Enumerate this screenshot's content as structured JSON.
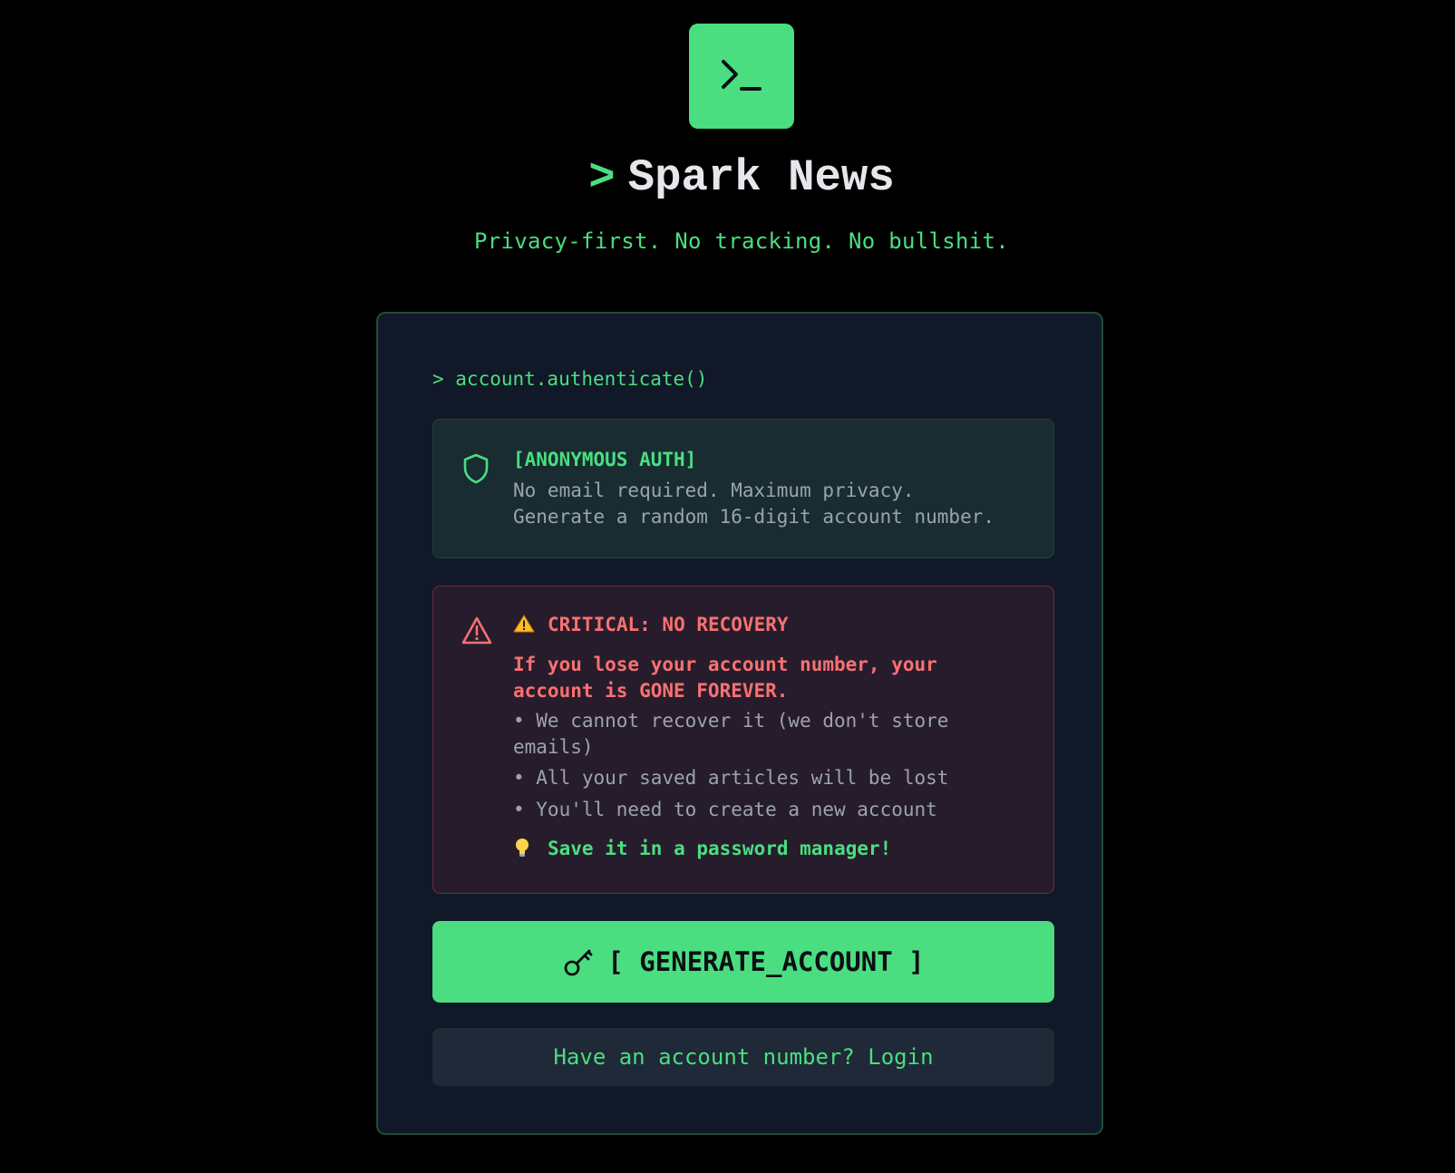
{
  "brand": {
    "logo_icon": "terminal-icon",
    "prompt_symbol": ">",
    "name": "Spark News",
    "tagline": "Privacy-first. No tracking. No bullshit."
  },
  "card": {
    "command": "> account.authenticate()",
    "info": {
      "icon": "shield-icon",
      "title": "[ANONYMOUS AUTH]",
      "line1": "No email required. Maximum privacy.",
      "line2": "Generate a random 16-digit account number."
    },
    "warning": {
      "icon": "alert-triangle-icon",
      "title": "CRITICAL: NO RECOVERY",
      "lead": "If you lose your account number, your account is GONE FOREVER.",
      "items": [
        "• We cannot recover it (we don't store emails)",
        "• All your saved articles will be lost",
        "• You'll need to create a new account"
      ],
      "tip": "Save it in a password manager!"
    },
    "generate_button": {
      "icon": "key-icon",
      "label": "[ GENERATE_ACCOUNT ]"
    },
    "login_button": {
      "label": "Have an account number? Login"
    }
  },
  "colors": {
    "accent": "#4ade80",
    "danger": "#f87171",
    "background": "#000000",
    "card": "#111827"
  }
}
